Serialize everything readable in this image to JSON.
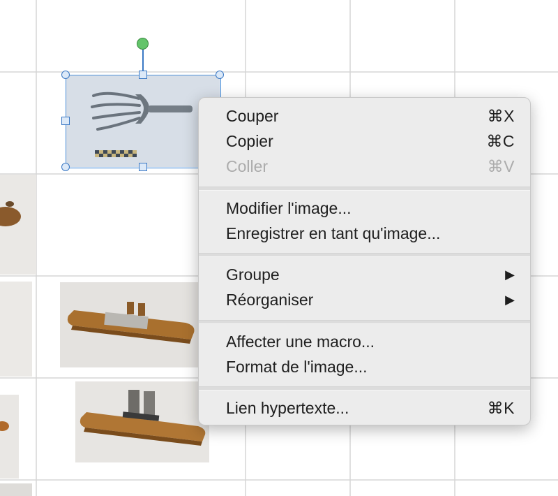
{
  "context_menu": {
    "items": [
      {
        "label": "Couper",
        "shortcut": "⌘X",
        "enabled": true
      },
      {
        "label": "Copier",
        "shortcut": "⌘C",
        "enabled": true
      },
      {
        "label": "Coller",
        "shortcut": "⌘V",
        "enabled": false
      },
      {
        "label": "Modifier l'image...",
        "shortcut": "",
        "enabled": true
      },
      {
        "label": "Enregistrer en tant qu'image...",
        "shortcut": "",
        "enabled": true
      },
      {
        "label": "Groupe",
        "submenu_arrow": "▶",
        "enabled": true
      },
      {
        "label": "Réorganiser",
        "submenu_arrow": "▶",
        "enabled": true
      },
      {
        "label": "Affecter une macro...",
        "shortcut": "",
        "enabled": true
      },
      {
        "label": "Format de l'image...",
        "shortcut": "",
        "enabled": true
      },
      {
        "label": "Lien hypertexte...",
        "shortcut": "⌘K",
        "enabled": true
      }
    ]
  },
  "colors": {
    "grid_line": "#d6d6d6",
    "selection": "#3a78c4",
    "rotation_handle": "#63c46a",
    "menu_bg": "#ececec",
    "disabled_text": "#acacac"
  },
  "images": [
    {
      "name": "pitchfork-image",
      "selected": true
    },
    {
      "name": "wood-tool-left-1"
    },
    {
      "name": "wood-tool-left-2"
    },
    {
      "name": "wood-tool-left-3"
    },
    {
      "name": "wooden-plane-1"
    },
    {
      "name": "wooden-plane-2"
    }
  ]
}
